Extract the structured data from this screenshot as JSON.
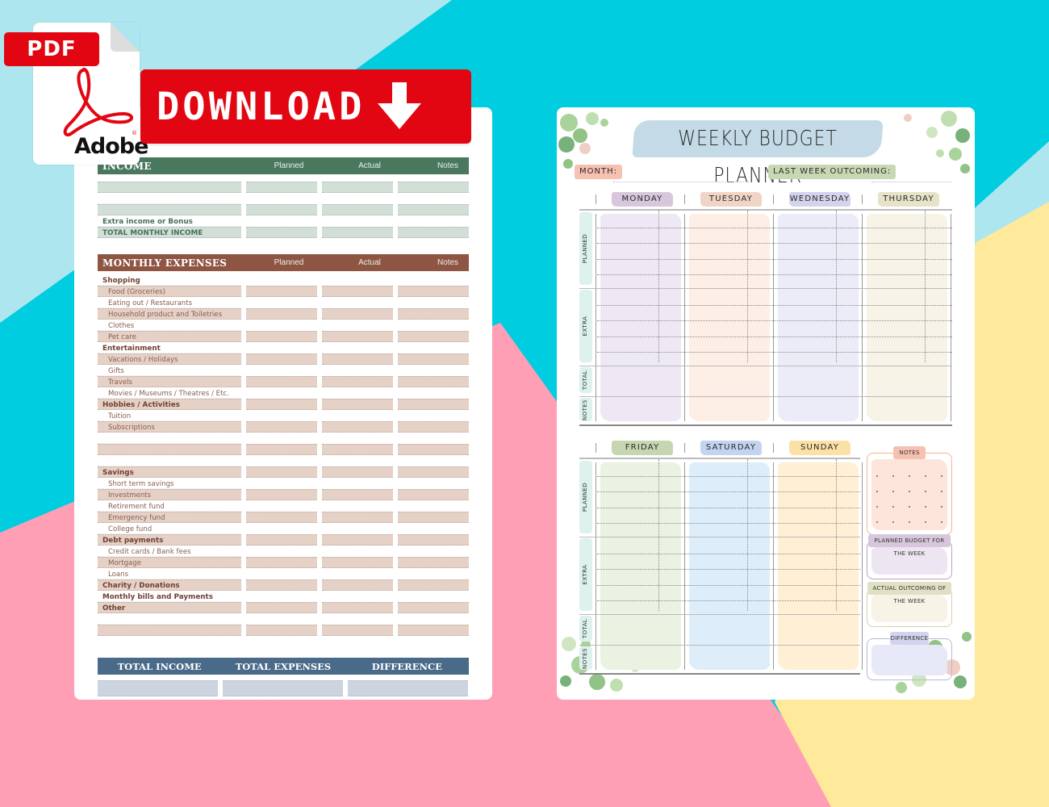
{
  "background": {
    "colors": {
      "light_blue": "#ADE6EF",
      "cyan": "#00CDE0",
      "pink": "#FF9FB6",
      "yellow": "#FFE99B"
    }
  },
  "badge": {
    "pdf_label": "PDF",
    "brand": "Adobe",
    "icon": "adobe-acrobat-icon",
    "color": "#E20612"
  },
  "download_button": {
    "label": "DOWNLOAD",
    "icon": "arrow-down-icon",
    "color": "#E20612"
  },
  "monthly_budget": {
    "income": {
      "title": "INCOME",
      "columns": [
        "Planned",
        "Actual",
        "Notes"
      ],
      "color": "#4A785F",
      "rows": [
        {
          "label": "",
          "shaded": true
        },
        {
          "label": "",
          "shaded": false
        },
        {
          "label": "",
          "shaded": true
        },
        {
          "label": "Extra income or Bonus",
          "shaded": false
        },
        {
          "label": "TOTAL MONTHLY INCOME",
          "shaded": true
        }
      ]
    },
    "expenses": {
      "title": "MONTHLY EXPENSES",
      "columns": [
        "Planned",
        "Actual",
        "Notes"
      ],
      "color": "#8E5542",
      "rows": [
        {
          "label": "Shopping",
          "category": true,
          "shaded": false
        },
        {
          "label": "Food (Groceries)",
          "category": false,
          "shaded": true
        },
        {
          "label": "Eating out / Restaurants",
          "category": false,
          "shaded": false
        },
        {
          "label": "Household product and Toiletries",
          "category": false,
          "shaded": true
        },
        {
          "label": "Clothes",
          "category": false,
          "shaded": false
        },
        {
          "label": "Pet care",
          "category": false,
          "shaded": true
        },
        {
          "label": "Entertainment",
          "category": true,
          "shaded": false
        },
        {
          "label": "Vacations / Holidays",
          "category": false,
          "shaded": true
        },
        {
          "label": "Gifts",
          "category": false,
          "shaded": false
        },
        {
          "label": "Travels",
          "category": false,
          "shaded": true
        },
        {
          "label": "Movies / Museums / Theatres / Etc.",
          "category": false,
          "shaded": false
        },
        {
          "label": "Hobbies / Activities",
          "category": true,
          "shaded": true
        },
        {
          "label": "Tuition",
          "category": false,
          "shaded": false
        },
        {
          "label": "Subscriptions",
          "category": false,
          "shaded": true
        },
        {
          "label": "",
          "category": false,
          "shaded": false
        },
        {
          "label": "",
          "category": false,
          "shaded": true
        },
        {
          "label": "",
          "category": false,
          "shaded": false
        },
        {
          "label": "Savings",
          "category": true,
          "shaded": true
        },
        {
          "label": "Short term savings",
          "category": false,
          "shaded": false
        },
        {
          "label": "Investments",
          "category": false,
          "shaded": true
        },
        {
          "label": "Retirement fund",
          "category": false,
          "shaded": false
        },
        {
          "label": "Emergency fund",
          "category": false,
          "shaded": true
        },
        {
          "label": "College fund",
          "category": false,
          "shaded": false
        },
        {
          "label": "Debt payments",
          "category": true,
          "shaded": true
        },
        {
          "label": "Credit cards / Bank fees",
          "category": false,
          "shaded": false
        },
        {
          "label": "Mortgage",
          "category": false,
          "shaded": true
        },
        {
          "label": "Loans",
          "category": false,
          "shaded": false
        },
        {
          "label": "Charity / Donations",
          "category": true,
          "shaded": true
        },
        {
          "label": "Monthly bills and Payments",
          "category": true,
          "shaded": false
        },
        {
          "label": "Other",
          "category": true,
          "shaded": true
        },
        {
          "label": "",
          "category": false,
          "shaded": false
        },
        {
          "label": "",
          "category": false,
          "shaded": true
        }
      ]
    },
    "totals": {
      "labels": [
        "TOTAL INCOME",
        "TOTAL EXPENSES",
        "DIFFERENCE"
      ],
      "color": "#4A6A89"
    }
  },
  "weekly_planner": {
    "title": "WEEKLY BUDGET PLANNER",
    "month_label": "MONTH:",
    "last_week_label": "LAST WEEK OUTCOMING:",
    "row_labels": [
      "PLANNED",
      "EXTRA",
      "TOTAL",
      "NOTES"
    ],
    "week_top": [
      {
        "day": "MONDAY",
        "tag_color": "#D8C7DC",
        "fill_color": "#EEE8F4"
      },
      {
        "day": "TUESDAY",
        "tag_color": "#F0D5C6",
        "fill_color": "#FDEEE6"
      },
      {
        "day": "WEDNESDAY",
        "tag_color": "#D3D3EE",
        "fill_color": "#ECECF8"
      },
      {
        "day": "THURSDAY",
        "tag_color": "#E6E3C9",
        "fill_color": "#F7F3E7"
      }
    ],
    "week_bottom": [
      {
        "day": "FRIDAY",
        "tag_color": "#C5D6B0",
        "fill_color": "#EAF2E2"
      },
      {
        "day": "SATURDAY",
        "tag_color": "#C2D4F0",
        "fill_color": "#DDEEFA"
      },
      {
        "day": "SUNDAY",
        "tag_color": "#FCE1A6",
        "fill_color": "#FFF0D5"
      }
    ],
    "side_boxes": [
      {
        "label": "NOTES",
        "border": "#F4B58E",
        "tag": "#F7C1B2",
        "fill": "#FDE5DC"
      },
      {
        "label": "PLANNED BUDGET FOR THE WEEK",
        "border": "#B9A2C2",
        "tag": "#D8C7DC",
        "fill": "#EDE6F2"
      },
      {
        "label": "ACTUAL OUTCOMING OF THE WEEK",
        "border": "#D4D2B0",
        "tag": "#E2E0C4",
        "fill": "#F7F3E6"
      },
      {
        "label": "DIFFERENCE",
        "border": "#B7B9D8",
        "tag": "#D3D3EE",
        "fill": "#E8E9F8"
      }
    ],
    "month_tag_color": "#F7C1B2",
    "last_week_tag_color": "#C9D8B4",
    "title_brush_color": "#C4DBE7"
  }
}
